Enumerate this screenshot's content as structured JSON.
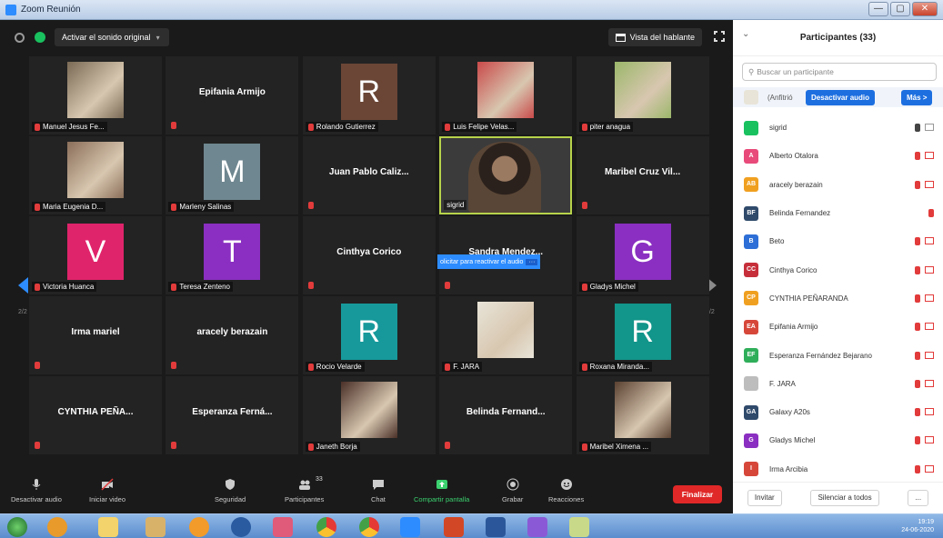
{
  "window": {
    "title": "Zoom Reunión",
    "controls": [
      "—",
      "▢",
      "✕"
    ]
  },
  "meeting_topbar": {
    "original_sound": "Activar el sonido original",
    "speaker_view": "Vista del hablante"
  },
  "tiles": [
    {
      "type": "photo",
      "label": "Manuel Jesus Fe...",
      "photo": "man-with-guitar",
      "color": "#7a6a55"
    },
    {
      "type": "name",
      "label": "Epifania Armijo"
    },
    {
      "type": "avatar",
      "label": "Rolando Gutierrez",
      "letter": "R",
      "color": "#6b4636"
    },
    {
      "type": "photo",
      "label": "Luis Felipe Velas...",
      "photo": "kids-photo",
      "color": "#c94a4a"
    },
    {
      "type": "photo",
      "label": "piter anagua",
      "photo": "illustration",
      "color": "#9bb76a"
    },
    {
      "type": "photo",
      "label": "Maria Eugenia D...",
      "photo": "two-girls-photo",
      "color": "#8b6f5a"
    },
    {
      "type": "avatar",
      "label": "Marleny Salinas",
      "letter": "M",
      "color": "#6f8790"
    },
    {
      "type": "name",
      "label": "Juan Pablo Caliz..."
    },
    {
      "type": "video",
      "label": "sigrid",
      "photo": "woman-glasses",
      "color": "#5a4636"
    },
    {
      "type": "name",
      "label": "Maribel Cruz Vil..."
    },
    {
      "type": "avatar",
      "label": "Victoria Huanca",
      "letter": "V",
      "color": "#e0246b"
    },
    {
      "type": "avatar",
      "label": "Teresa Zenteno",
      "letter": "T",
      "color": "#8a2fc1"
    },
    {
      "type": "name",
      "label": "Cinthya Corico"
    },
    {
      "type": "name",
      "label": "Sandra Mendez..."
    },
    {
      "type": "avatar",
      "label": "Gladys Michel",
      "letter": "G",
      "color": "#8a2fc1"
    },
    {
      "type": "name",
      "label": "Irma mariel"
    },
    {
      "type": "name",
      "label": "aracely berazain"
    },
    {
      "type": "avatar",
      "label": "Rocio Velarde",
      "letter": "R",
      "color": "#17999b"
    },
    {
      "type": "photo",
      "label": "F. JARA",
      "photo": "document-sign",
      "color": "#e8e4d8"
    },
    {
      "type": "avatar",
      "label": "Roxana Miranda...",
      "letter": "R",
      "color": "#12958a"
    },
    {
      "type": "name",
      "label": "CYNTHIA PEÑA..."
    },
    {
      "type": "name",
      "label": "Esperanza Ferná..."
    },
    {
      "type": "photo",
      "label": "Janeth Borja",
      "photo": "woman-portrait",
      "color": "#4a3028"
    },
    {
      "type": "name",
      "label": "Belinda Fernand..."
    },
    {
      "type": "photo",
      "label": "Maribel Ximena ...",
      "photo": "woman-portrait-2",
      "color": "#5b4232"
    }
  ],
  "reactivate_audio": "olicitar para reactivar el audio",
  "pagination": {
    "left": "2/2",
    "right": "2/2"
  },
  "toolbar": {
    "mute": "Desactivar audio",
    "video": "Iniciar video",
    "security": "Seguridad",
    "participants": "Participantes",
    "participants_count": "33",
    "chat": "Chat",
    "share": "Compartir pantalla",
    "record": "Grabar",
    "reactions": "Reacciones",
    "end": "Finalizar"
  },
  "panel": {
    "title": "Participantes (33)",
    "search_placeholder": "Buscar un participante",
    "host_suffix": "(Anfitrió",
    "mute_btn": "Desactivar audio",
    "more_btn": "Más >",
    "invite": "Invitar",
    "mute_all": "Silenciar a todos",
    "more_foot": "..."
  },
  "participants": [
    {
      "name": "sigrid",
      "initials": "",
      "color": "#19c15f",
      "mic": "on",
      "cam": "off-grey"
    },
    {
      "name": "Alberto Otalora",
      "initials": "A",
      "color": "#e84a7a",
      "mic": "muted",
      "cam": "off"
    },
    {
      "name": "aracely berazain",
      "initials": "AB",
      "color": "#f0a020",
      "mic": "muted",
      "cam": "off"
    },
    {
      "name": "Belinda Fernandez",
      "initials": "BF",
      "color": "#2f4a6b",
      "mic": "muted",
      "cam": "none"
    },
    {
      "name": "Beto",
      "initials": "B",
      "color": "#2d6fd6",
      "mic": "muted",
      "cam": "off"
    },
    {
      "name": "Cinthya Corico",
      "initials": "CC",
      "color": "#c62f3a",
      "mic": "muted",
      "cam": "off"
    },
    {
      "name": "CYNTHIA PEÑARANDA",
      "initials": "CP",
      "color": "#f0a020",
      "mic": "muted",
      "cam": "off"
    },
    {
      "name": "Epifania Armijo",
      "initials": "EA",
      "color": "#d6473a",
      "mic": "muted",
      "cam": "off"
    },
    {
      "name": "Esperanza Fernández Bejarano",
      "initials": "EF",
      "color": "#2fae5a",
      "mic": "muted",
      "cam": "off"
    },
    {
      "name": "F. JARA",
      "initials": "",
      "color": "#bdbdbd",
      "mic": "muted",
      "cam": "off"
    },
    {
      "name": "Galaxy A20s",
      "initials": "GA",
      "color": "#2f4a6b",
      "mic": "muted",
      "cam": "off"
    },
    {
      "name": "Gladys Michel",
      "initials": "G",
      "color": "#8a2fc1",
      "mic": "muted",
      "cam": "off"
    },
    {
      "name": "Irma Arcibia",
      "initials": "I",
      "color": "#d6473a",
      "mic": "muted",
      "cam": "off"
    }
  ],
  "taskbar": {
    "time": "19:19",
    "date": "24-06-2020"
  },
  "colors": {
    "accent": "#2d8cff",
    "end": "#e02828",
    "mute": "#e23b3b",
    "active_border": "#b7d34b"
  }
}
